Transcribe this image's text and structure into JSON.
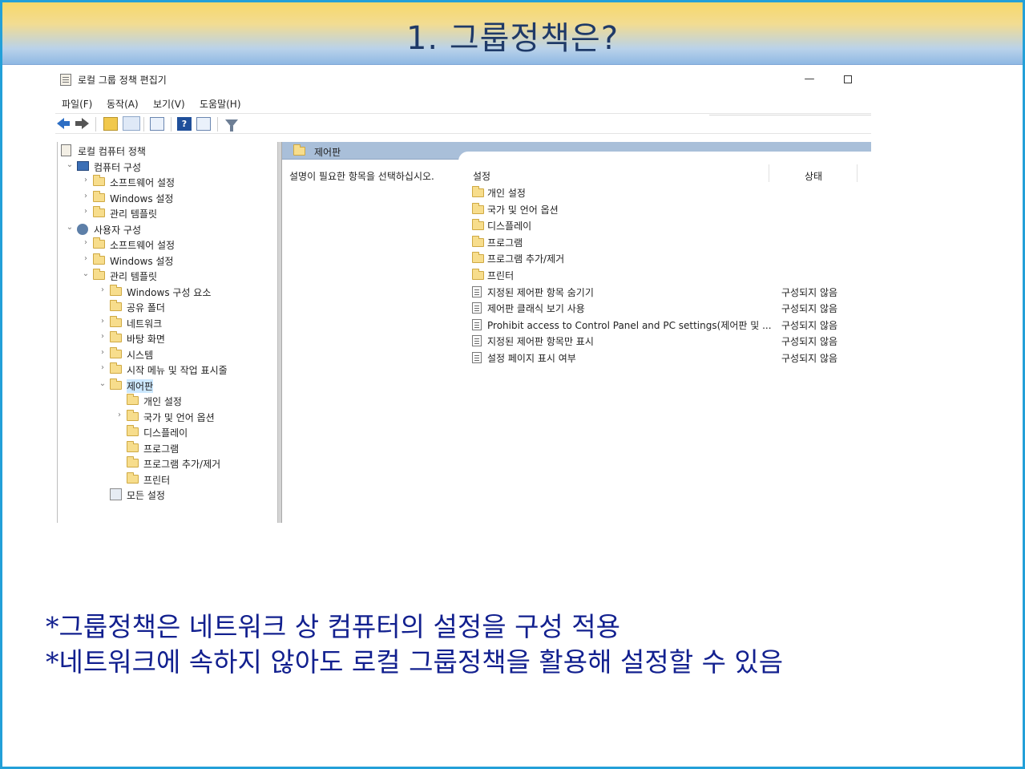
{
  "slide": {
    "title": "1. 그룹정책은?"
  },
  "window": {
    "title": "로컬 그룹 정책 편집기",
    "minimize": "—",
    "menu": [
      "파일(F)",
      "동작(A)",
      "보기(V)",
      "도움말(H)"
    ],
    "toolbar": [
      "back-icon",
      "forward-icon",
      "folder-up-icon",
      "show-hide-icon",
      "export-icon",
      "help-icon",
      "properties-icon",
      "filter-icon"
    ]
  },
  "tree": [
    {
      "label": "로컬 컴퓨터 정책",
      "level": 0,
      "icon": "document-icon",
      "chev": ""
    },
    {
      "label": "컴퓨터 구성",
      "level": 1,
      "icon": "computer-icon",
      "chev": "⌄"
    },
    {
      "label": "소프트웨어 설정",
      "level": 2,
      "icon": "folder-icon",
      "chev": "›"
    },
    {
      "label": "Windows 설정",
      "level": 2,
      "icon": "folder-icon",
      "chev": "›"
    },
    {
      "label": "관리 템플릿",
      "level": 2,
      "icon": "folder-icon",
      "chev": "›"
    },
    {
      "label": "사용자 구성",
      "level": 1,
      "icon": "user-icon",
      "chev": "⌄"
    },
    {
      "label": "소프트웨어 설정",
      "level": 2,
      "icon": "folder-icon",
      "chev": "›"
    },
    {
      "label": "Windows 설정",
      "level": 2,
      "icon": "folder-icon",
      "chev": "›"
    },
    {
      "label": "관리 템플릿",
      "level": 2,
      "icon": "folder-icon",
      "chev": "⌄"
    },
    {
      "label": "Windows 구성 요소",
      "level": 3,
      "icon": "folder-icon",
      "chev": "›"
    },
    {
      "label": "공유 폴더",
      "level": 3,
      "icon": "folder-icon",
      "chev": ""
    },
    {
      "label": "네트워크",
      "level": 3,
      "icon": "folder-icon",
      "chev": "›"
    },
    {
      "label": "바탕 화면",
      "level": 3,
      "icon": "folder-icon",
      "chev": "›"
    },
    {
      "label": "시스템",
      "level": 3,
      "icon": "folder-icon",
      "chev": "›"
    },
    {
      "label": "시작 메뉴 및 작업 표시줄",
      "level": 3,
      "icon": "folder-icon",
      "chev": "›"
    },
    {
      "label": "제어판",
      "level": 3,
      "icon": "folder-icon",
      "chev": "⌄",
      "selected": true
    },
    {
      "label": "개인 설정",
      "level": 4,
      "icon": "folder-icon",
      "chev": ""
    },
    {
      "label": "국가 및 언어 옵션",
      "level": 4,
      "icon": "folder-icon",
      "chev": "›"
    },
    {
      "label": "디스플레이",
      "level": 4,
      "icon": "folder-icon",
      "chev": ""
    },
    {
      "label": "프로그램",
      "level": 4,
      "icon": "folder-icon",
      "chev": ""
    },
    {
      "label": "프로그램 추가/제거",
      "level": 4,
      "icon": "folder-icon",
      "chev": ""
    },
    {
      "label": "프린터",
      "level": 4,
      "icon": "folder-icon",
      "chev": ""
    },
    {
      "label": "모든 설정",
      "level": 3,
      "icon": "all-settings-icon",
      "chev": ""
    }
  ],
  "right": {
    "header": "제어판",
    "description": "설명이 필요한 항목을 선택하십시오.",
    "col_setting": "설정",
    "col_state": "상태",
    "items": [
      {
        "name": "개인 설정",
        "type": "folder",
        "state": ""
      },
      {
        "name": "국가 및 언어 옵션",
        "type": "folder",
        "state": ""
      },
      {
        "name": "디스플레이",
        "type": "folder",
        "state": ""
      },
      {
        "name": "프로그램",
        "type": "folder",
        "state": ""
      },
      {
        "name": "프로그램 추가/제거",
        "type": "folder",
        "state": ""
      },
      {
        "name": "프린터",
        "type": "folder",
        "state": ""
      },
      {
        "name": "지정된 제어판 항목 숨기기",
        "type": "setting",
        "state": "구성되지 않음"
      },
      {
        "name": "제어판 클래식 보기 사용",
        "type": "setting",
        "state": "구성되지 않음"
      },
      {
        "name": "Prohibit access to Control Panel and PC settings(제어판 및 ...",
        "type": "setting",
        "state": "구성되지 않음"
      },
      {
        "name": "지정된 제어판 항목만 표시",
        "type": "setting",
        "state": "구성되지 않음"
      },
      {
        "name": "설정 페이지 표시 여부",
        "type": "setting",
        "state": "구성되지 않음"
      }
    ]
  },
  "body_lines": [
    "*그룹정책은 네트워크 상 컴퓨터의 설정을 구성 적용",
    "*네트워크에 속하지 않아도 로컬 그룹정책을 활용해 설정할 수 있음"
  ]
}
